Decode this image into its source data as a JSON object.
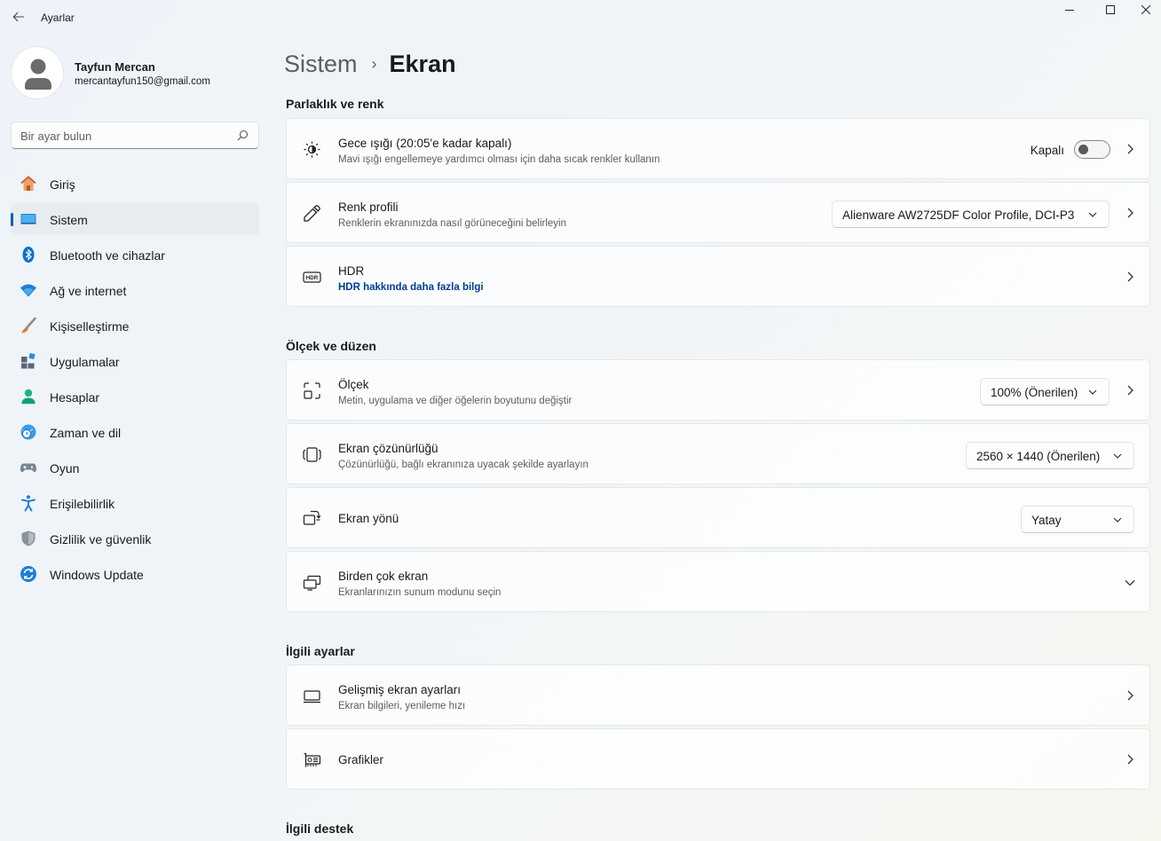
{
  "window": {
    "title": "Ayarlar"
  },
  "profile": {
    "name": "Tayfun Mercan",
    "email": "mercantayfun150@gmail.com"
  },
  "search": {
    "placeholder": "Bir ayar bulun"
  },
  "nav": {
    "items": [
      {
        "label": "Giriş",
        "icon": "home-icon"
      },
      {
        "label": "Sistem",
        "icon": "system-icon",
        "active": true
      },
      {
        "label": "Bluetooth ve cihazlar",
        "icon": "bluetooth-icon"
      },
      {
        "label": "Ağ ve internet",
        "icon": "wifi-icon"
      },
      {
        "label": "Kişiselleştirme",
        "icon": "brush-icon"
      },
      {
        "label": "Uygulamalar",
        "icon": "apps-icon"
      },
      {
        "label": "Hesaplar",
        "icon": "person-icon"
      },
      {
        "label": "Zaman ve dil",
        "icon": "clock-globe-icon"
      },
      {
        "label": "Oyun",
        "icon": "gamepad-icon"
      },
      {
        "label": "Erişilebilirlik",
        "icon": "accessibility-icon"
      },
      {
        "label": "Gizlilik ve güvenlik",
        "icon": "shield-icon"
      },
      {
        "label": "Windows Update",
        "icon": "update-icon"
      }
    ]
  },
  "breadcrumb": {
    "parent": "Sistem",
    "separator": "›",
    "current": "Ekran"
  },
  "sections": {
    "brightness": "Parlaklık ve renk",
    "scale": "Ölçek ve düzen",
    "related": "İlgili ayarlar",
    "support": "İlgili destek"
  },
  "cards": {
    "night_light": {
      "title": "Gece ışığı (20:05'e kadar kapalı)",
      "subtitle": "Mavi ışığı engellemeye yardımcı olması için daha sıcak renkler kullanın",
      "toggle_label": "Kapalı",
      "toggle_on": false
    },
    "color_profile": {
      "title": "Renk profili",
      "subtitle": "Renklerin ekranınızda nasıl görüneceğini belirleyin",
      "value": "Alienware AW2725DF Color Profile, DCI-P3"
    },
    "hdr": {
      "title": "HDR",
      "link": "HDR hakkında daha fazla bilgi"
    },
    "scale": {
      "title": "Ölçek",
      "subtitle": "Metin, uygulama ve diğer öğelerin boyutunu değiştir",
      "value": "100% (Önerilen)"
    },
    "resolution": {
      "title": "Ekran çözünürlüğü",
      "subtitle": "Çözünürlüğü, bağlı ekranınıza uyacak şekilde ayarlayın",
      "value": "2560 × 1440 (Önerilen)"
    },
    "orientation": {
      "title": "Ekran yönü",
      "value": "Yatay"
    },
    "multi_display": {
      "title": "Birden çok ekran",
      "subtitle": "Ekranlarınızın sunum modunu seçin"
    },
    "advanced": {
      "title": "Gelişmiş ekran ayarları",
      "subtitle": "Ekran bilgileri, yenileme hızı"
    },
    "graphics": {
      "title": "Grafikler"
    }
  },
  "colors": {
    "accent": "#005fb8",
    "link": "#003e92"
  }
}
